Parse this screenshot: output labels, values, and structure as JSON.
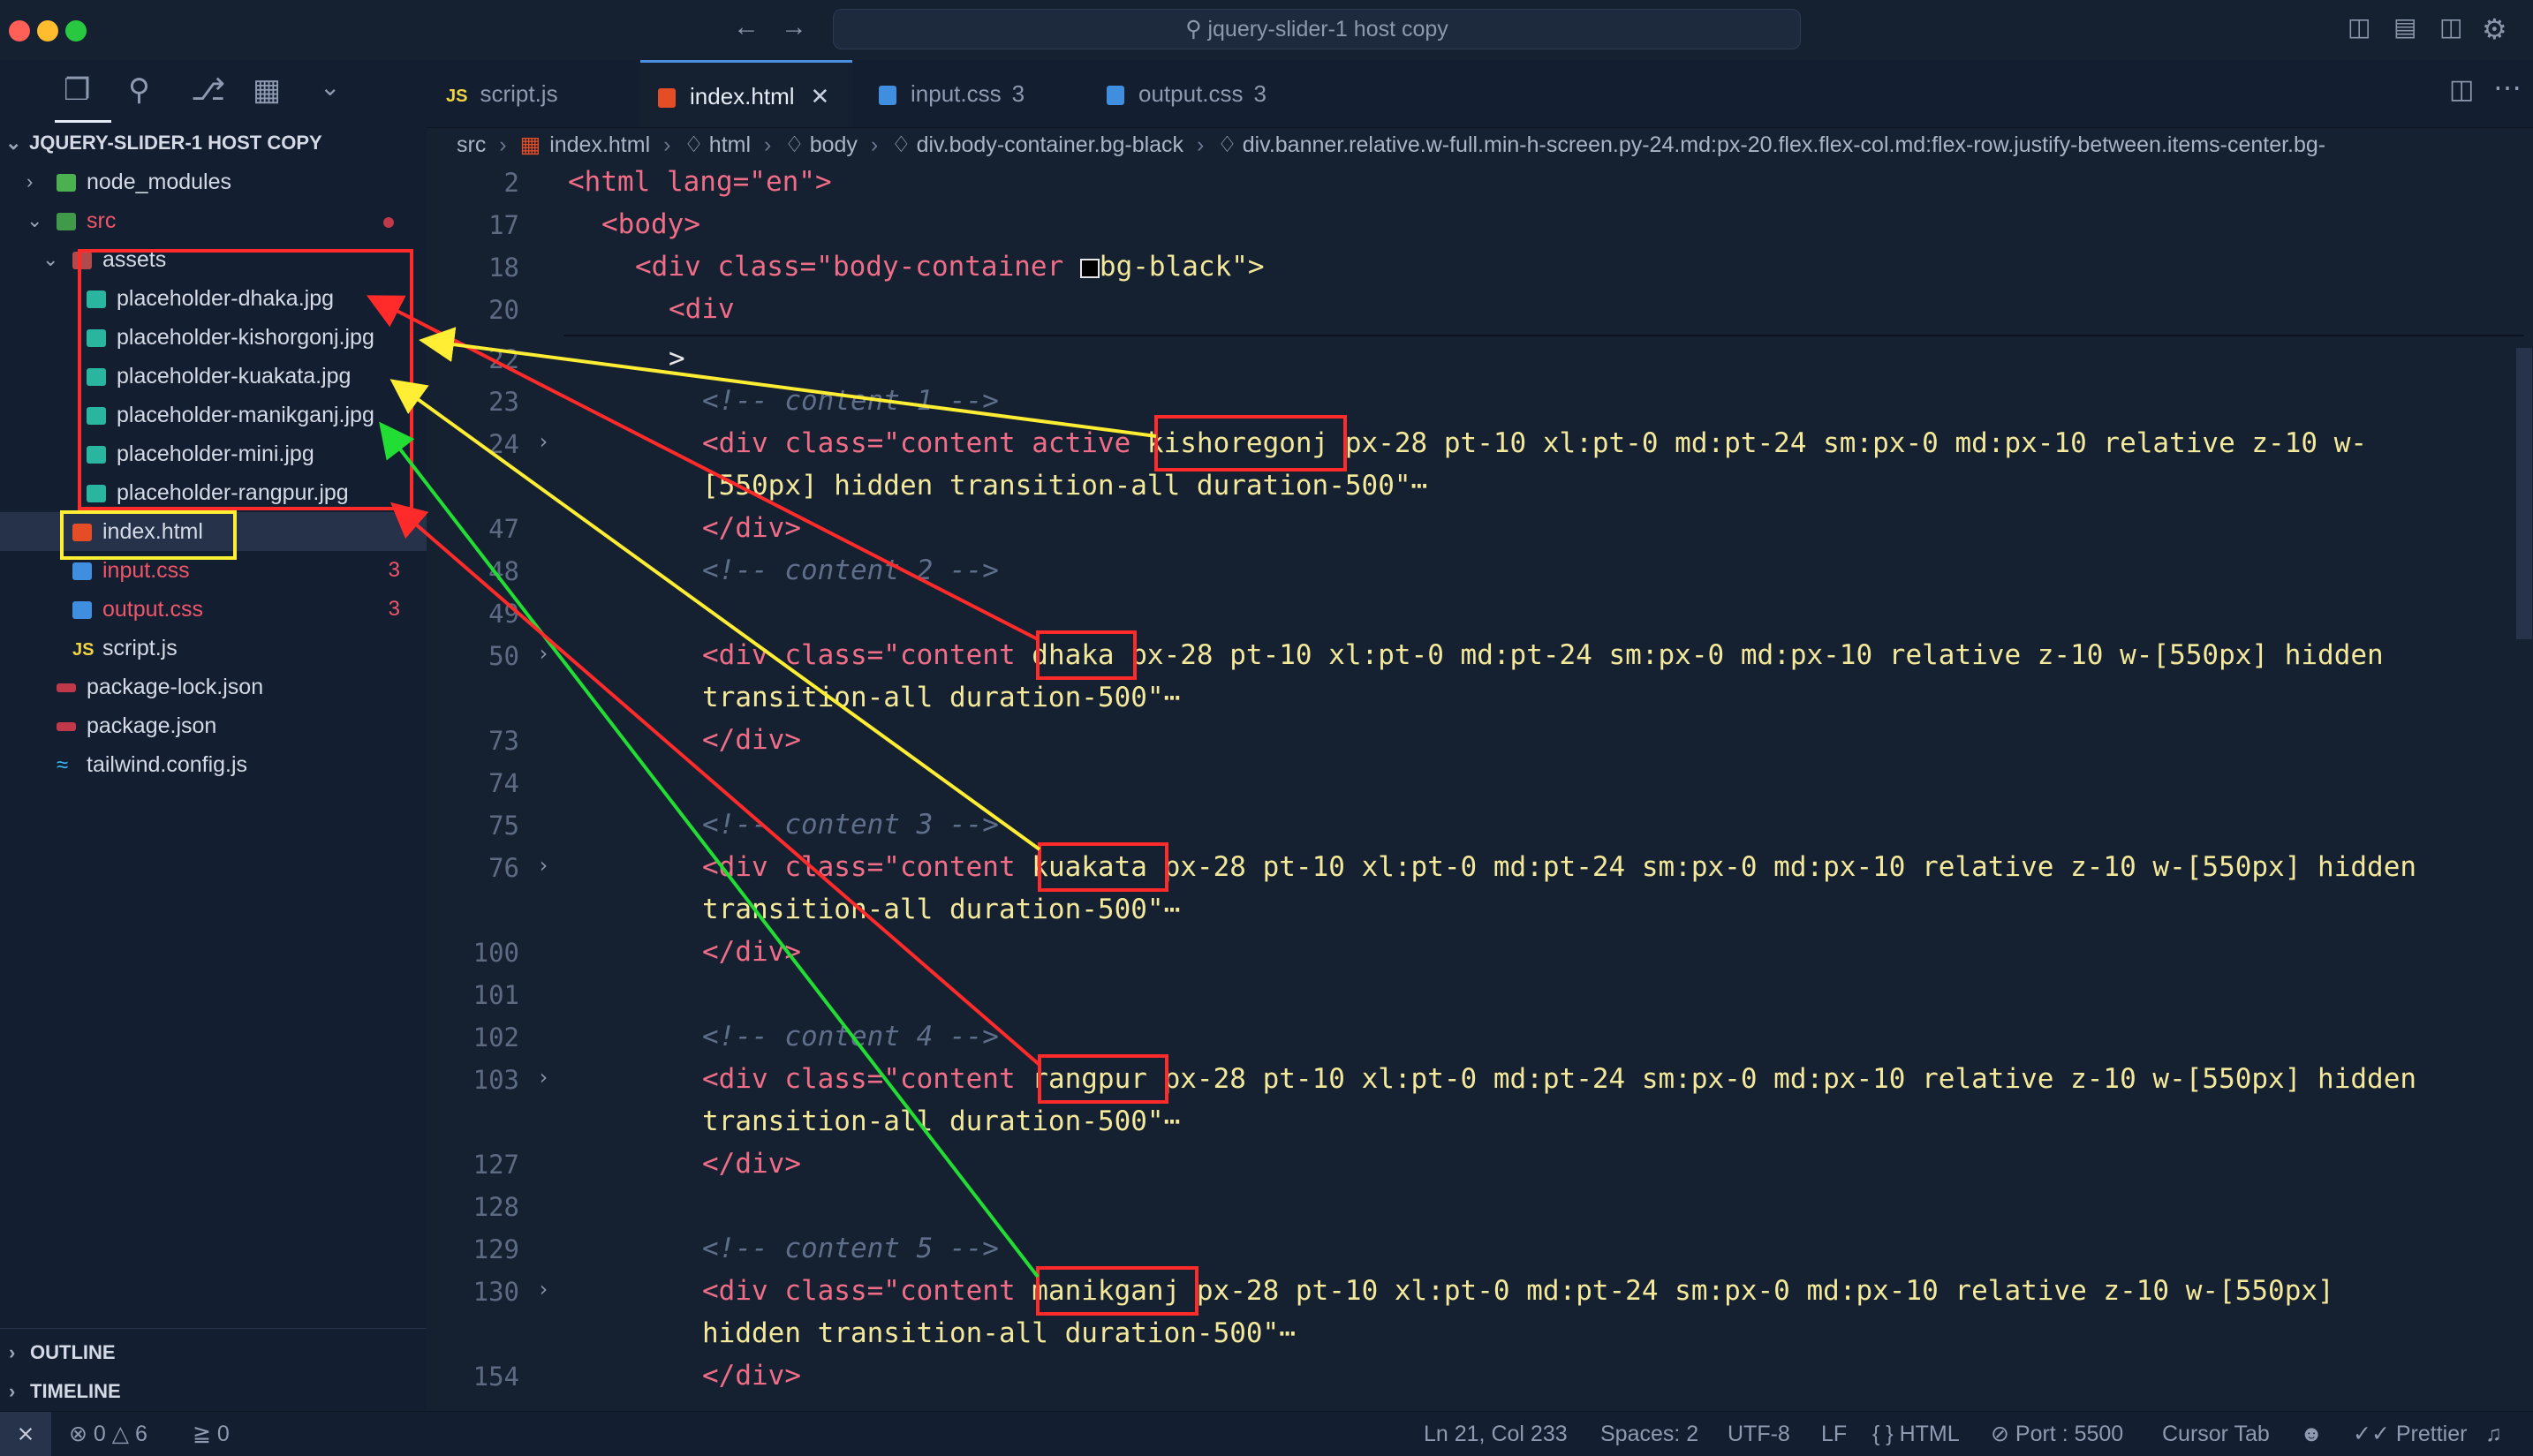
{
  "window": {
    "title": "jquery-slider-1 host copy"
  },
  "sidebar": {
    "root": "JQUERY-SLIDER-1 HOST COPY",
    "items": [
      {
        "label": "node_modules",
        "color": "#d4dbe6"
      },
      {
        "label": "src",
        "color": "#f0566a"
      },
      {
        "label": "assets",
        "color": "#d4dbe6"
      },
      {
        "label": "placeholder-dhaka.jpg"
      },
      {
        "label": "placeholder-kishorgonj.jpg"
      },
      {
        "label": "placeholder-kuakata.jpg"
      },
      {
        "label": "placeholder-manikganj.jpg"
      },
      {
        "label": "placeholder-mini.jpg"
      },
      {
        "label": "placeholder-rangpur.jpg"
      },
      {
        "label": "index.html"
      },
      {
        "label": "input.css",
        "badge": "3"
      },
      {
        "label": "output.css",
        "badge": "3"
      },
      {
        "label": "script.js"
      },
      {
        "label": "package-lock.json"
      },
      {
        "label": "package.json"
      },
      {
        "label": "tailwind.config.js"
      }
    ],
    "outline": "OUTLINE",
    "timeline": "TIMELINE"
  },
  "tabs": [
    {
      "label": "script.js",
      "icon": "JS"
    },
    {
      "label": "index.html",
      "icon": "html"
    },
    {
      "label": "input.css",
      "badge": "3"
    },
    {
      "label": "output.css",
      "badge": "3"
    }
  ],
  "breadcrumb": {
    "parts": [
      "src",
      "index.html",
      "html",
      "body",
      "div.body-container.bg-black",
      "div.banner.relative.w-full.min-h-screen.py-24.md:px-20.flex.flex-col.md:flex-row.justify-between.items-center.bg-"
    ]
  },
  "editor": {
    "line_numbers": [
      "2",
      "17",
      "18",
      "20",
      "22",
      "23",
      "24",
      "",
      "47",
      "48",
      "49",
      "50",
      "",
      "73",
      "74",
      "75",
      "76",
      "",
      "100",
      "101",
      "102",
      "103",
      "",
      "127",
      "128",
      "129",
      "130",
      "",
      "154"
    ],
    "lines": {
      "l2": "<html lang=\"en\">",
      "l17": "<body>",
      "l18": "<div class=\"body-container ",
      "l18b": "bg-black\">",
      "l20": "<div",
      "l22": ">",
      "c1": "<!-- content 1 -->",
      "c2": "<!-- content 2 -->",
      "c3": "<!-- content 3 -->",
      "c4": "<!-- content 4 -->",
      "c5": "<!-- content 5 -->",
      "close": "</div>"
    },
    "blocks": [
      {
        "pre": "<div class=\"content active ",
        "name": "kishoregonj",
        "post": " px-28 pt-10 xl:pt-0 md:pt-24 sm:px-0 md:px-10 relative z-10 w-",
        "line2": "[550px] hidden transition-all duration-500\"⋯"
      },
      {
        "pre": "<div class=\"content ",
        "name": "dhaka",
        "post": " px-28 pt-10 xl:pt-0 md:pt-24 sm:px-0 md:px-10 relative z-10 w-[550px] hidden",
        "line2": "transition-all duration-500\"⋯"
      },
      {
        "pre": "<div class=\"content ",
        "name": "kuakata",
        "post": " px-28 pt-10 xl:pt-0 md:pt-24 sm:px-0 md:px-10 relative z-10 w-[550px] hidden",
        "line2": "transition-all duration-500\"⋯"
      },
      {
        "pre": "<div class=\"content ",
        "name": "rangpur",
        "post": " px-28 pt-10 xl:pt-0 md:pt-24 sm:px-0 md:px-10 relative z-10 w-[550px] hidden",
        "line2": "transition-all duration-500\"⋯"
      },
      {
        "pre": "<div class=\"content ",
        "name": "manikganj",
        "post": " px-28 pt-10 xl:pt-0 md:pt-24 sm:px-0 md:px-10 relative z-10 w-[550px]",
        "line2": "hidden transition-all duration-500\"⋯"
      }
    ]
  },
  "status": {
    "errors": "0",
    "warnings": "6",
    "ports": "0",
    "position": "Ln 21, Col 233",
    "spaces": "Spaces: 2",
    "encoding": "UTF-8",
    "eol": "LF",
    "language": "HTML",
    "port": "Port : 5500",
    "cursor_tab": "Cursor Tab",
    "prettier": "Prettier"
  },
  "colors": {
    "annotation_red": "#ff2b2b",
    "annotation_yellow": "#ffee33",
    "annotation_green": "#22dd33"
  }
}
